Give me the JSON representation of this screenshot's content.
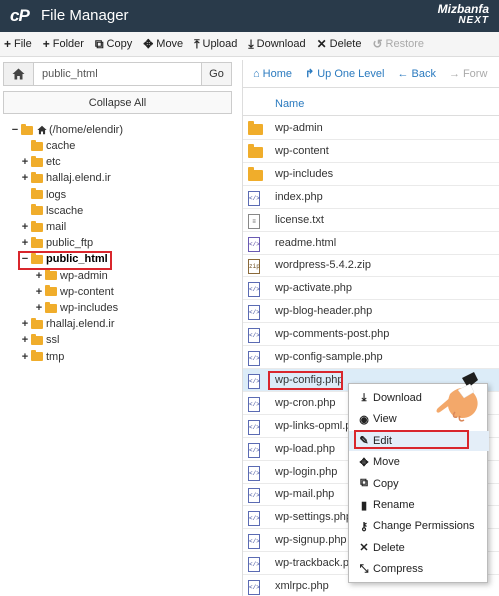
{
  "header": {
    "logo": "cP",
    "title": "File Manager",
    "brand_name": "Mizbanfa",
    "brand_sub": "NEXT"
  },
  "toolbar": [
    {
      "icon": "plus-icon",
      "glyph": "+",
      "label": "File",
      "disabled": false
    },
    {
      "icon": "plus-icon",
      "glyph": "+",
      "label": "Folder",
      "disabled": false
    },
    {
      "icon": "copy-icon",
      "glyph": "⧉",
      "label": "Copy",
      "disabled": false
    },
    {
      "icon": "move-icon",
      "glyph": "✥",
      "label": "Move",
      "disabled": false
    },
    {
      "icon": "upload-icon",
      "glyph": "⤒",
      "label": "Upload",
      "disabled": false
    },
    {
      "icon": "download-icon",
      "glyph": "⤓",
      "label": "Download",
      "disabled": false
    },
    {
      "icon": "delete-icon",
      "glyph": "✕",
      "label": "Delete",
      "disabled": false
    },
    {
      "icon": "restore-icon",
      "glyph": "↺",
      "label": "Restore",
      "disabled": true
    }
  ],
  "path_bar": {
    "value": "public_html",
    "go_label": "Go"
  },
  "collapse_label": "Collapse All",
  "tree": {
    "root_label": "(/home/elendir)",
    "items": [
      {
        "label": "cache",
        "toggle": ""
      },
      {
        "label": "etc",
        "toggle": "+"
      },
      {
        "label": "hallaj.elend.ir",
        "toggle": "+"
      },
      {
        "label": "logs",
        "toggle": ""
      },
      {
        "label": "lscache",
        "toggle": ""
      },
      {
        "label": "mail",
        "toggle": "+"
      },
      {
        "label": "public_ftp",
        "toggle": "+"
      },
      {
        "label": "public_html",
        "toggle": "−",
        "selected": true
      },
      {
        "label": "wp-admin",
        "toggle": "+",
        "child": true
      },
      {
        "label": "wp-content",
        "toggle": "+",
        "child": true
      },
      {
        "label": "wp-includes",
        "toggle": "+",
        "child": true
      },
      {
        "label": "rhallaj.elend.ir",
        "toggle": "+"
      },
      {
        "label": "ssl",
        "toggle": "+"
      },
      {
        "label": "tmp",
        "toggle": "+"
      }
    ]
  },
  "nav": [
    {
      "icon": "home-icon",
      "glyph": "⌂",
      "label": "Home",
      "disabled": false
    },
    {
      "icon": "level-up-icon",
      "glyph": "↱",
      "label": "Up One Level",
      "disabled": false
    },
    {
      "icon": "arrow-left-icon",
      "glyph": "←",
      "label": "Back",
      "disabled": false
    },
    {
      "icon": "arrow-right-icon",
      "glyph": "→",
      "label": "Forw",
      "disabled": true
    }
  ],
  "file_list": {
    "column_name": "Name",
    "files": [
      {
        "name": "wp-admin",
        "type": "folder"
      },
      {
        "name": "wp-content",
        "type": "folder"
      },
      {
        "name": "wp-includes",
        "type": "folder"
      },
      {
        "name": "index.php",
        "type": "php"
      },
      {
        "name": "license.txt",
        "type": "txt"
      },
      {
        "name": "readme.html",
        "type": "html"
      },
      {
        "name": "wordpress-5.4.2.zip",
        "type": "zip"
      },
      {
        "name": "wp-activate.php",
        "type": "php"
      },
      {
        "name": "wp-blog-header.php",
        "type": "php"
      },
      {
        "name": "wp-comments-post.php",
        "type": "php"
      },
      {
        "name": "wp-config-sample.php",
        "type": "php"
      },
      {
        "name": "wp-config.php",
        "type": "php",
        "selected": true
      },
      {
        "name": "wp-cron.php",
        "type": "php"
      },
      {
        "name": "wp-links-opml.php",
        "type": "php"
      },
      {
        "name": "wp-load.php",
        "type": "php"
      },
      {
        "name": "wp-login.php",
        "type": "php"
      },
      {
        "name": "wp-mail.php",
        "type": "php"
      },
      {
        "name": "wp-settings.php",
        "type": "php"
      },
      {
        "name": "wp-signup.php",
        "type": "php"
      },
      {
        "name": "wp-trackback.php",
        "type": "php"
      },
      {
        "name": "xmlrpc.php",
        "type": "php"
      }
    ]
  },
  "context_menu": [
    {
      "icon": "download-icon",
      "glyph": "⤓",
      "label": "Download"
    },
    {
      "icon": "eye-icon",
      "glyph": "◉",
      "label": "View"
    },
    {
      "icon": "pencil-icon",
      "glyph": "✎",
      "label": "Edit",
      "active": true
    },
    {
      "icon": "move-icon",
      "glyph": "✥",
      "label": "Move"
    },
    {
      "icon": "copy-icon",
      "glyph": "⧉",
      "label": "Copy"
    },
    {
      "icon": "file-icon",
      "glyph": "▮",
      "label": "Rename"
    },
    {
      "icon": "key-icon",
      "glyph": "⚷",
      "label": "Change Permissions"
    },
    {
      "icon": "delete-icon",
      "glyph": "✕",
      "label": "Delete"
    },
    {
      "icon": "compress-icon",
      "glyph": "⤡",
      "label": "Compress"
    }
  ],
  "colors": {
    "header_bg": "#293a4a",
    "link_blue": "#2a7abf",
    "folder": "#f0ad2b",
    "highlight_red": "#d9262c",
    "selected_row": "#dcecf8"
  }
}
